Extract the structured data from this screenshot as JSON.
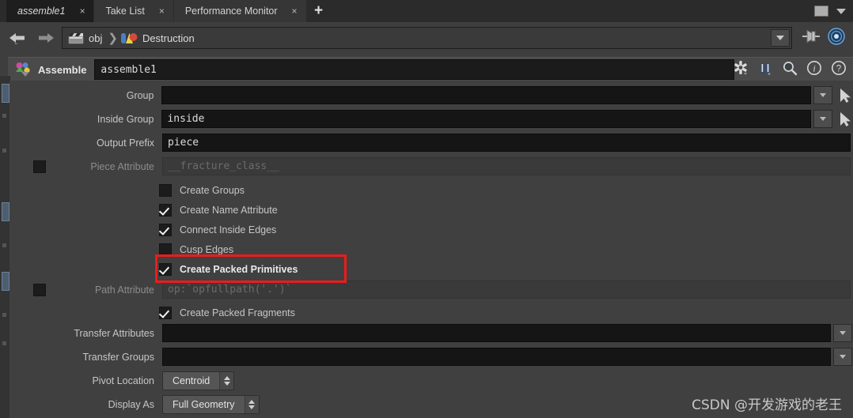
{
  "window": {
    "restore_icon": "restore-window-icon",
    "menu_icon": "chevron-down-icon"
  },
  "tabs": {
    "items": [
      {
        "label": "assemble1",
        "close": "×",
        "active": true
      },
      {
        "label": "Take List",
        "close": "×",
        "active": false
      },
      {
        "label": "Performance Monitor",
        "close": "×",
        "active": false
      }
    ],
    "new_tab": "+"
  },
  "pathbar": {
    "back": "back-arrow-icon",
    "forward": "forward-arrow-icon",
    "crumbs": [
      {
        "icon": "obj-network-icon",
        "label": "obj"
      },
      {
        "icon": "geometry-node-icon",
        "label": "Destruction"
      }
    ],
    "separator": "❯",
    "dropdown": "chevron-down-icon",
    "pin_icon": "pin-icon",
    "target_icon": "target-icon"
  },
  "node_header": {
    "icon": "assemble-node-icon",
    "type_label": "Assemble",
    "name_value": "assemble1",
    "icons": [
      "gear-icon",
      "houdini-h-icon",
      "search-icon",
      "info-icon",
      "help-icon"
    ]
  },
  "parameters": {
    "group": {
      "label": "Group",
      "value": "",
      "dropdown": "chevron-down-icon",
      "picker": "pointer-arrow-icon"
    },
    "inside_group": {
      "label": "Inside Group",
      "value": "inside",
      "dropdown": "chevron-down-icon",
      "picker": "pointer-arrow-icon"
    },
    "output_prefix": {
      "label": "Output Prefix",
      "value": "piece"
    },
    "piece_attribute": {
      "label": "Piece Attribute",
      "placeholder": "__fracture_class__",
      "enabled": false,
      "toggle": "parameter-enable-toggle"
    },
    "checkboxes": [
      {
        "label": "Create Groups",
        "checked": false,
        "highlighted": false
      },
      {
        "label": "Create Name Attribute",
        "checked": true,
        "highlighted": false
      },
      {
        "label": "Connect Inside Edges",
        "checked": true,
        "highlighted": false
      },
      {
        "label": "Cusp Edges",
        "checked": false,
        "highlighted": false
      },
      {
        "label": "Create Packed Primitives",
        "checked": true,
        "highlighted": true
      }
    ],
    "path_attribute": {
      "label": "Path Attribute",
      "placeholder": "op:`opfullpath('.')`",
      "enabled": false,
      "toggle": "parameter-enable-toggle"
    },
    "create_packed_fragments": {
      "label": "Create Packed Fragments",
      "checked": true
    },
    "transfer_attributes": {
      "label": "Transfer Attributes",
      "value": "",
      "dropdown": "chevron-down-icon"
    },
    "transfer_groups": {
      "label": "Transfer Groups",
      "value": "",
      "dropdown": "chevron-down-icon"
    },
    "pivot_location": {
      "label": "Pivot Location",
      "value": "Centroid",
      "spinner": "spinner-arrows-icon"
    },
    "display_as": {
      "label": "Display As",
      "value": "Full Geometry",
      "spinner": "spinner-arrows-icon"
    }
  },
  "annotation": {
    "highlight_color": "#ee1b1b"
  },
  "watermark": {
    "text": "CSDN @开发游戏的老王"
  }
}
